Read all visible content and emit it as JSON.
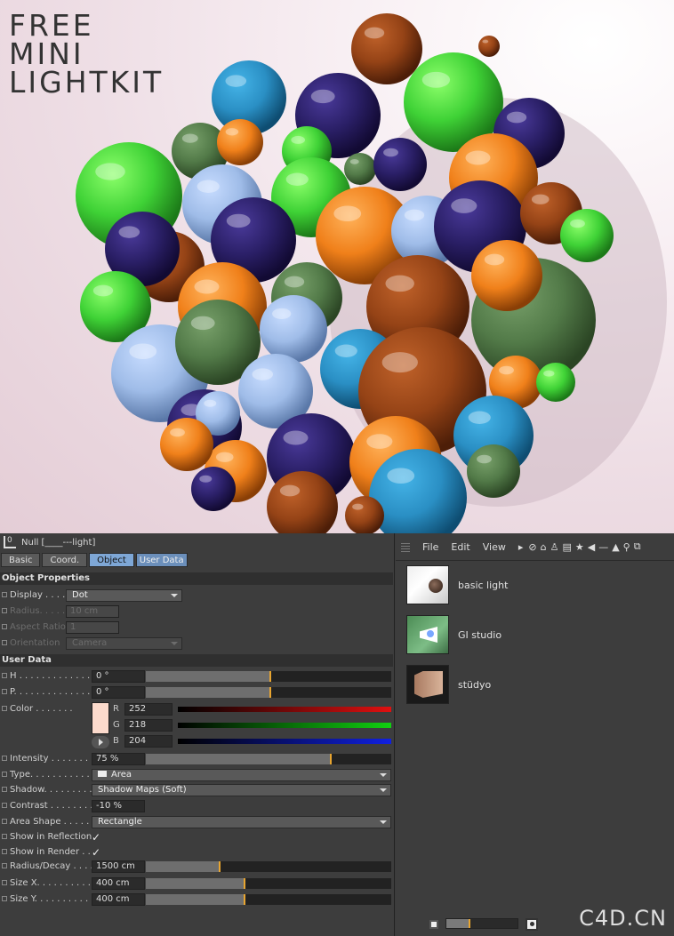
{
  "banner": {
    "line1": "FREE",
    "line2": "MINI",
    "line3": "LIGHTKIT"
  },
  "attributes": {
    "header": "Null [____---light]",
    "tabs": [
      "Basic",
      "Coord.",
      "Object",
      "User Data"
    ],
    "active_tab": "Object",
    "object_properties": "Object Properties",
    "display": {
      "label": "Display . . . .",
      "value": "Dot"
    },
    "radius": {
      "label": "Radius. . . . . .",
      "value": "10 cm"
    },
    "aspect": {
      "label": "Aspect Ratio",
      "value": "1"
    },
    "orientation": {
      "label": "Orientation",
      "value": "Camera"
    },
    "user_data": "User Data",
    "h": {
      "label": "H . . . . . . . . . . . . . .",
      "value": "0 °"
    },
    "p": {
      "label": "P. . . . . . . . . . . . . . .",
      "value": "0 °"
    },
    "color": {
      "label": "Color . . . . . . .",
      "r_label": "R",
      "r": "252",
      "g_label": "G",
      "g": "218",
      "b_label": "B",
      "b": "204",
      "swatch": "#fcdacc"
    },
    "intensity": {
      "label": "Intensity . . . . . . . .",
      "value": "75 %",
      "level": 0.75
    },
    "type": {
      "label": "Type. . . . . . . . . . . .",
      "value": "Area"
    },
    "shadow": {
      "label": "Shadow. . . . . . . . . .",
      "value": "Shadow Maps (Soft)"
    },
    "contrast": {
      "label": "Contrast . . . . . . . .",
      "value": "-10 %"
    },
    "area_shape": {
      "label": "Area Shape . . . . . .",
      "value": "Rectangle"
    },
    "show_reflection": {
      "label": "Show in Reflection",
      "check": "✓"
    },
    "show_render": {
      "label": "Show in Render . .",
      "check": "✓"
    },
    "radius_decay": {
      "label": "Radius/Decay . . . .",
      "value": "1500 cm"
    },
    "size_x": {
      "label": "Size X. . . . . . . . . . .",
      "value": "400 cm"
    },
    "size_y": {
      "label": "Size Y. . . . . . . . . . .",
      "value": "400 cm"
    }
  },
  "content_manager": {
    "menu": [
      "File",
      "Edit",
      "View"
    ],
    "items": [
      {
        "label": "basic light"
      },
      {
        "label": "GI studio"
      },
      {
        "label": "stüdyo"
      }
    ]
  },
  "watermark": "C4D.CN",
  "colors": {
    "accent": "#7ea7d6",
    "slider_mark": "#e8a530",
    "panel": "#3d3d3d"
  }
}
